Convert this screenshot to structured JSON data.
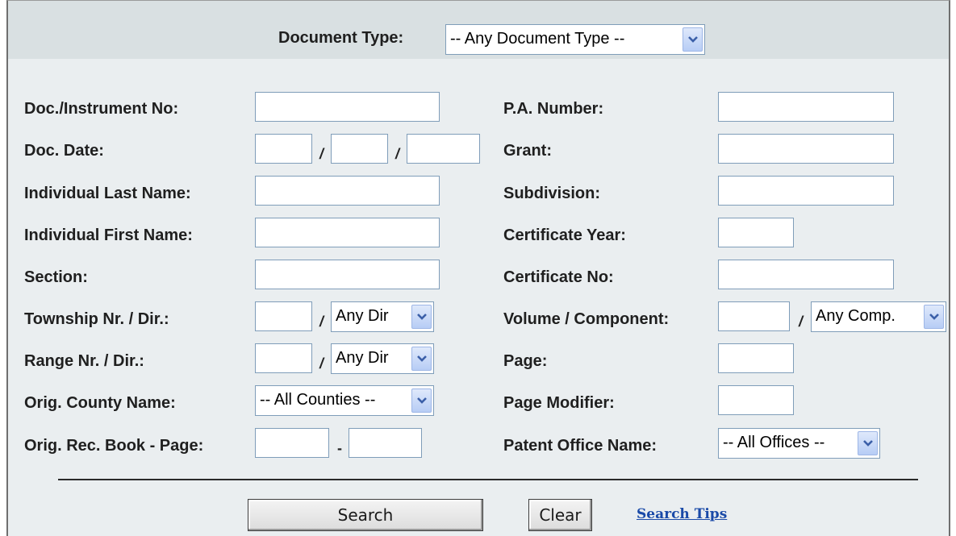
{
  "header": {
    "document_type_label": "Document Type:",
    "document_type_value": "-- Any Document Type --"
  },
  "left_fields": {
    "doc_instrument_no": "Doc./Instrument No:",
    "doc_date": "Doc. Date:",
    "last_name": "Individual Last Name:",
    "first_name": "Individual First Name:",
    "section": "Section:",
    "township": "Township Nr. / Dir.:",
    "range": "Range Nr. / Dir.:",
    "county": "Orig. County Name:",
    "rec_book_page": "Orig. Rec. Book - Page:"
  },
  "right_fields": {
    "pa_number": "P.A. Number:",
    "grant": "Grant:",
    "subdivision": "Subdivision:",
    "certificate_year": "Certificate Year:",
    "certificate_no": "Certificate No:",
    "volume_component": "Volume / Component:",
    "page": "Page:",
    "page_modifier": "Page Modifier:",
    "patent_office": "Patent Office Name:"
  },
  "separators": {
    "slash": "/",
    "dash": "-"
  },
  "selects": {
    "township_dir": "Any Dir",
    "range_dir": "Any Dir",
    "county": "-- All Counties --",
    "component": "Any Comp.",
    "patent_office": "-- All Offices --"
  },
  "buttons": {
    "search": "Search",
    "clear": "Clear"
  },
  "links": {
    "search_tips": "Search Tips"
  },
  "icons": {
    "dropdown": "chevron-down-icon"
  },
  "colors": {
    "panel_bg": "#eaeef0",
    "header_bg": "#d9e0e2",
    "input_border": "#7f9db9",
    "dropdown_button": "#b7cdf5",
    "link": "#1a4aa8"
  }
}
